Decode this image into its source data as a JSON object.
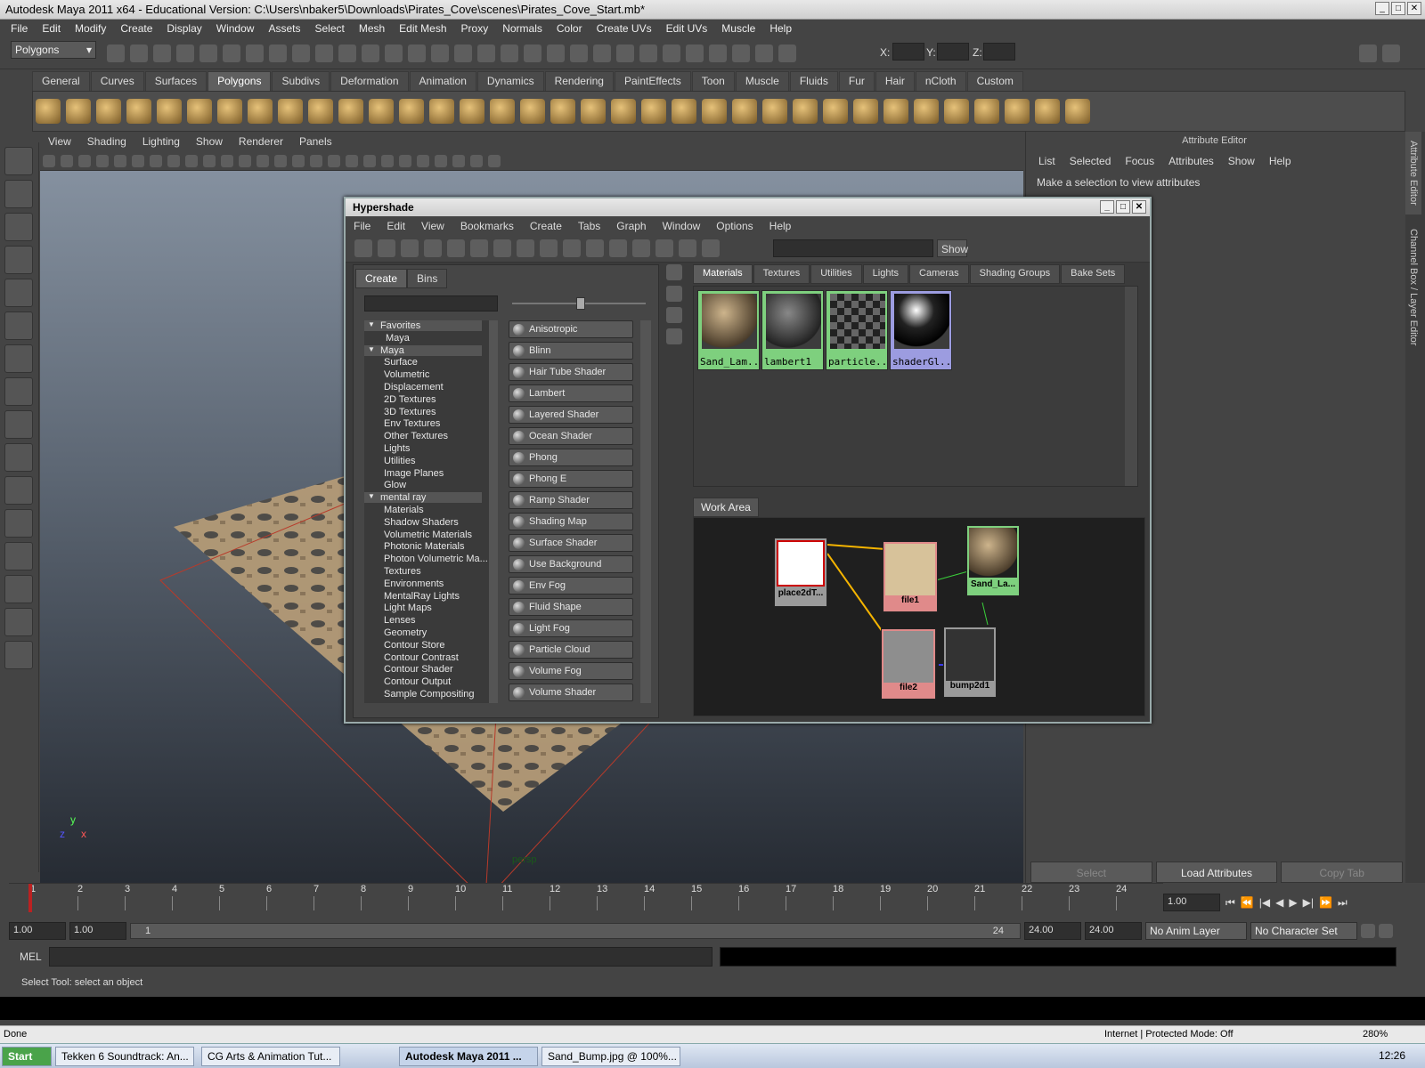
{
  "window": {
    "title": "Autodesk Maya 2011 x64 - Educational Version: C:\\Users\\nbaker5\\Downloads\\Pirates_Cove\\scenes\\Pirates_Cove_Start.mb*"
  },
  "main_menu": [
    "File",
    "Edit",
    "Modify",
    "Create",
    "Display",
    "Window",
    "Assets",
    "Select",
    "Mesh",
    "Edit Mesh",
    "Proxy",
    "Normals",
    "Color",
    "Create UVs",
    "Edit UVs",
    "Muscle",
    "Help"
  ],
  "toolbar": {
    "mode": "Polygons",
    "x_label": "X:",
    "y_label": "Y:",
    "z_label": "Z:"
  },
  "shelf_tabs": [
    "General",
    "Curves",
    "Surfaces",
    "Polygons",
    "Subdivs",
    "Deformation",
    "Animation",
    "Dynamics",
    "Rendering",
    "PaintEffects",
    "Toon",
    "Muscle",
    "Fluids",
    "Fur",
    "Hair",
    "nCloth",
    "Custom"
  ],
  "shelf_active": "Polygons",
  "viewport": {
    "menu": [
      "View",
      "Shading",
      "Lighting",
      "Show",
      "Renderer",
      "Panels"
    ],
    "camera_label": "persp",
    "axis_y": "y",
    "axis_x": "x",
    "axis_z": "z"
  },
  "attribute_editor": {
    "title": "Attribute Editor",
    "menu": [
      "List",
      "Selected",
      "Focus",
      "Attributes",
      "Show",
      "Help"
    ],
    "message": "Make a selection to view attributes",
    "buttons": {
      "select": "Select",
      "load": "Load Attributes",
      "copy": "Copy Tab"
    },
    "side_tab_1": "Attribute Editor",
    "side_tab_2": "Channel Box / Layer Editor"
  },
  "hypershade": {
    "title": "Hypershade",
    "menu": [
      "File",
      "Edit",
      "View",
      "Bookmarks",
      "Create",
      "Tabs",
      "Graph",
      "Window",
      "Options",
      "Help"
    ],
    "show_button": "Show",
    "left_tabs": [
      "Create",
      "Bins"
    ],
    "tree": [
      {
        "label": "Favorites",
        "cat": true
      },
      {
        "label": "Maya",
        "cat": false,
        "indent": 1
      },
      {
        "label": "Maya",
        "cat": true
      },
      {
        "label": "Surface"
      },
      {
        "label": "Volumetric"
      },
      {
        "label": "Displacement"
      },
      {
        "label": "2D Textures"
      },
      {
        "label": "3D Textures"
      },
      {
        "label": "Env Textures"
      },
      {
        "label": "Other Textures"
      },
      {
        "label": "Lights"
      },
      {
        "label": "Utilities"
      },
      {
        "label": "Image Planes"
      },
      {
        "label": "Glow"
      },
      {
        "label": "mental ray",
        "cat": true
      },
      {
        "label": "Materials"
      },
      {
        "label": "Shadow Shaders"
      },
      {
        "label": "Volumetric Materials"
      },
      {
        "label": "Photonic Materials"
      },
      {
        "label": "Photon Volumetric Ma..."
      },
      {
        "label": "Textures"
      },
      {
        "label": "Environments"
      },
      {
        "label": "MentalRay Lights"
      },
      {
        "label": "Light Maps"
      },
      {
        "label": "Lenses"
      },
      {
        "label": "Geometry"
      },
      {
        "label": "Contour Store"
      },
      {
        "label": "Contour Contrast"
      },
      {
        "label": "Contour Shader"
      },
      {
        "label": "Contour Output"
      },
      {
        "label": "Sample Compositing"
      }
    ],
    "nodes": [
      "Anisotropic",
      "Blinn",
      "Hair Tube Shader",
      "Lambert",
      "Layered Shader",
      "Ocean Shader",
      "Phong",
      "Phong E",
      "Ramp Shader",
      "Shading Map",
      "Surface Shader",
      "Use Background",
      "Env Fog",
      "Fluid Shape",
      "Light Fog",
      "Particle Cloud",
      "Volume Fog",
      "Volume Shader"
    ],
    "tabs": [
      "Materials",
      "Textures",
      "Utilities",
      "Lights",
      "Cameras",
      "Shading Groups",
      "Bake Sets"
    ],
    "active_tab": "Materials",
    "swatches": [
      {
        "label": "Sand_Lam...",
        "color": "#7ed07e"
      },
      {
        "label": "lambert1",
        "color": "#7ed07e"
      },
      {
        "label": "particle...",
        "color": "#7ed07e"
      },
      {
        "label": "shaderGl...",
        "color": "#9c9ce0"
      }
    ],
    "work_area_tab": "Work Area",
    "work_nodes": {
      "place2d": "place2dT...",
      "file1": "file1",
      "file2": "file2",
      "bump": "bump2d1",
      "sand": "Sand_La..."
    }
  },
  "timeline": {
    "ticks": [
      "1",
      "2",
      "3",
      "4",
      "5",
      "6",
      "7",
      "8",
      "9",
      "10",
      "11",
      "12",
      "13",
      "14",
      "15",
      "16",
      "17",
      "18",
      "19",
      "20",
      "21",
      "22",
      "23",
      "24"
    ],
    "current_frame": "1.00"
  },
  "range": {
    "start": "1.00",
    "start2": "1.00",
    "slider_start": "1",
    "slider_end": "24",
    "end": "24.00",
    "end2": "24.00",
    "anim_layer": "No Anim Layer",
    "char_set": "No Character Set"
  },
  "mel": {
    "label": "MEL"
  },
  "help_line": "Select Tool: select an object",
  "ie_status": {
    "left": "Done",
    "zone": "Internet | Protected Mode: Off",
    "zoom": "280%"
  },
  "taskbar": {
    "start": "Start",
    "tasks": [
      "Tekken 6 Soundtrack: An...",
      "CG Arts & Animation Tut...",
      "Autodesk Maya 2011 ...",
      "Sand_Bump.jpg @ 100%..."
    ],
    "clock": "12:26"
  }
}
